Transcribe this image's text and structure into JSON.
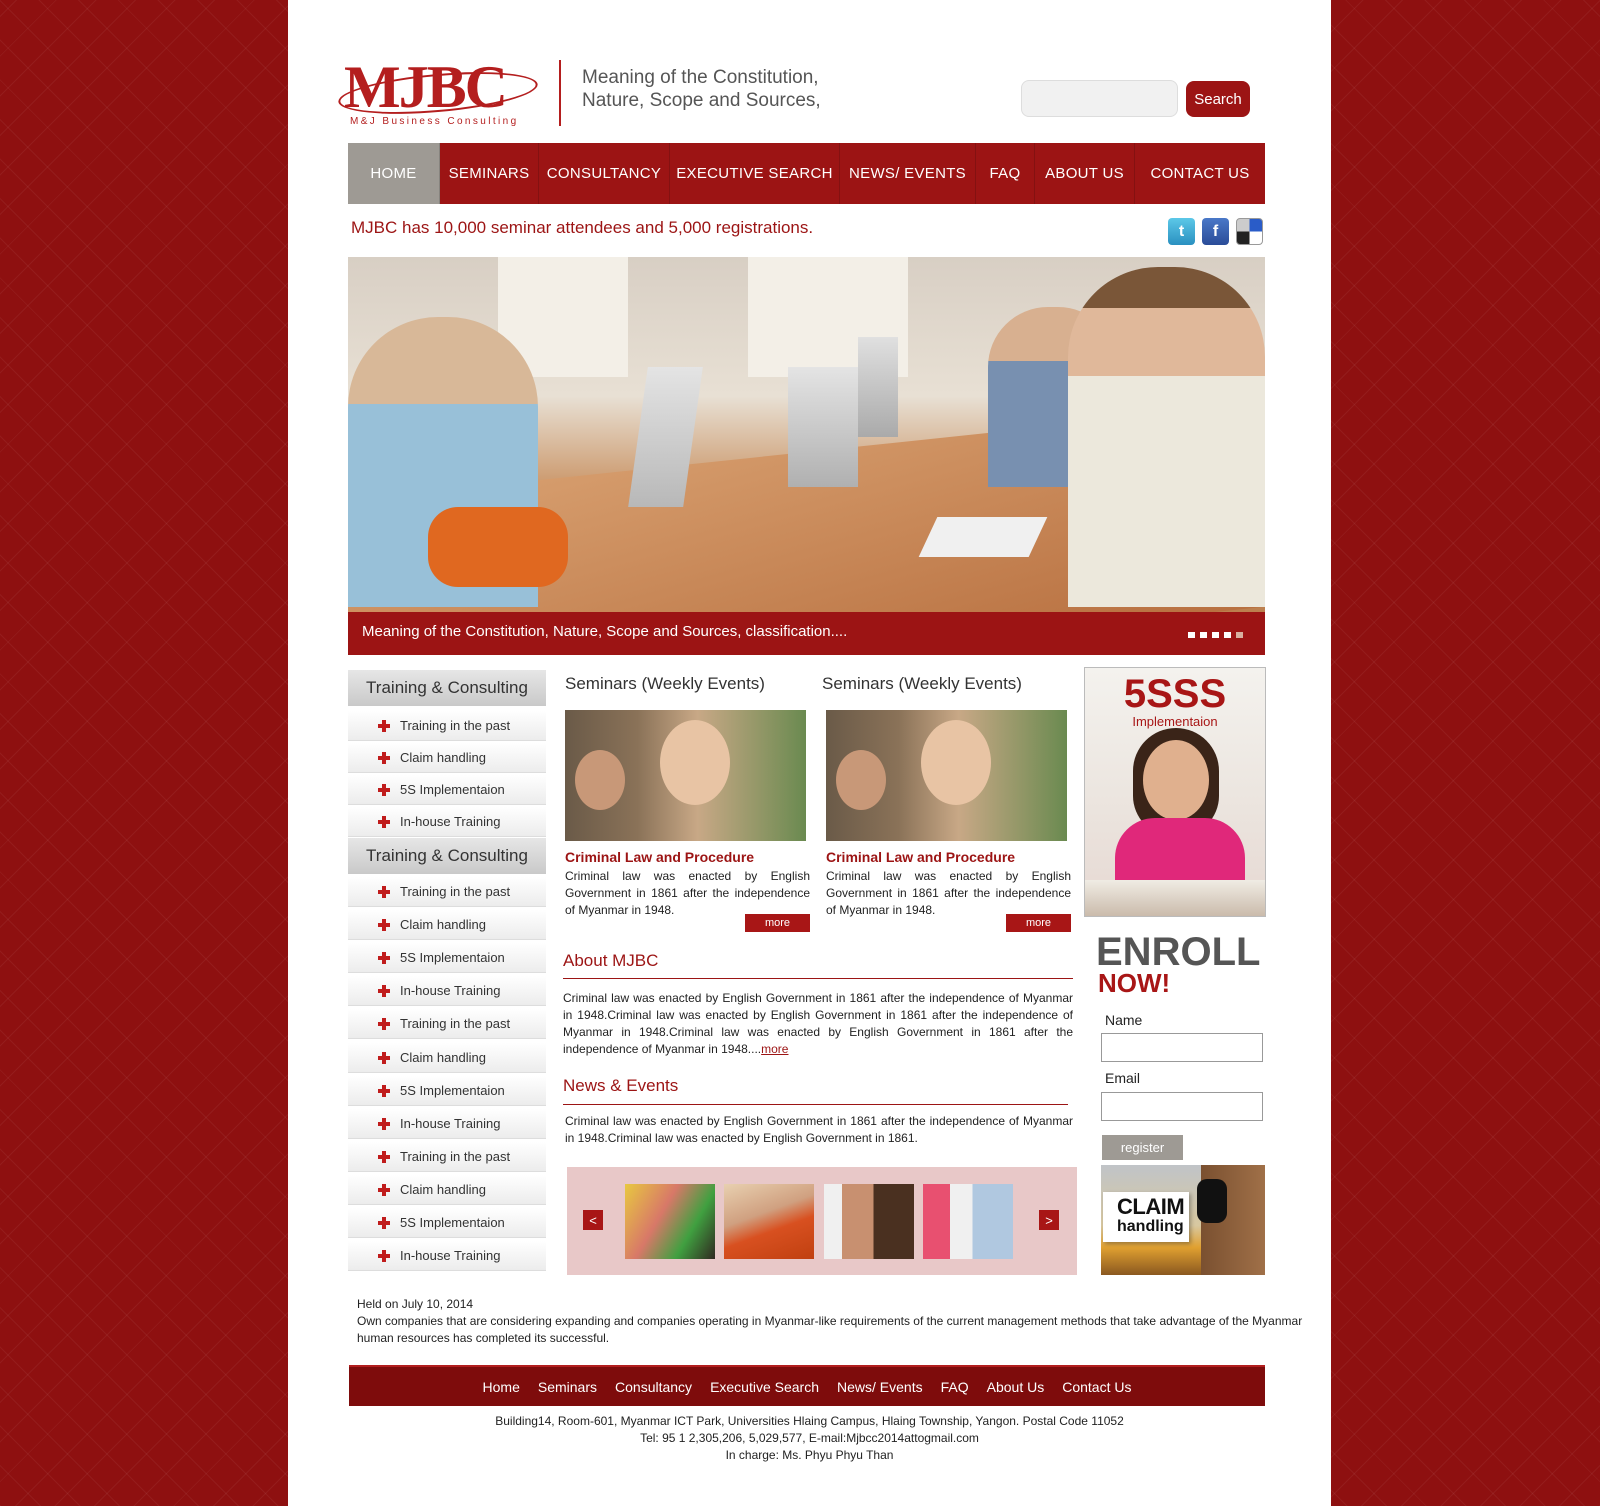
{
  "header": {
    "logo_text": "MJBC",
    "logo_subtitle": "M&J Business Consulting",
    "tagline_line1": "Meaning of the Constitution,",
    "tagline_line2": "Nature, Scope and Sources,",
    "search_placeholder": "",
    "search_label": "Search"
  },
  "nav": {
    "items": [
      "HOME",
      "SEMINARS",
      "CONSULTANCY",
      "EXECUTIVE SEARCH",
      "NEWS/ EVENTS",
      "FAQ",
      "ABOUT US",
      "CONTACT US"
    ],
    "active": "HOME"
  },
  "ticker": "MJBC has 10,000 seminar attendees and 5,000 registrations.",
  "social": {
    "twitter": "t",
    "facebook": "f",
    "delicious": ""
  },
  "hero": {
    "caption": "Meaning of the Constitution, Nature, Scope and Sources, classification...."
  },
  "sidebar": {
    "heading1": "Training & Consulting",
    "group1": [
      "Training in the past",
      "Claim handling",
      "5S Implementaion",
      "In-house Training"
    ],
    "heading2": "Training & Consulting",
    "group2": [
      "Training in the past",
      "Claim handling",
      "5S Implementaion",
      "In-house Training",
      "Training in the past",
      "Claim handling",
      "5S Implementaion",
      "In-house Training",
      "Training in the past",
      "Claim handling",
      "5S Implementaion",
      "In-house Training"
    ]
  },
  "seminars": [
    {
      "title": "Seminars (Weekly Events)",
      "subtitle": "Criminal Law and Procedure",
      "text": "Criminal law was enacted by English Government in 1861 after the independence of Myanmar in 1948.",
      "more": "more"
    },
    {
      "title": "Seminars (Weekly Events)",
      "subtitle": "Criminal Law and Procedure",
      "text": "Criminal law was enacted by English Government in 1861 after the independence of Myanmar in 1948.",
      "more": "more"
    }
  ],
  "about": {
    "title": "About MJBC",
    "text": "Criminal law was enacted by English Government in 1861 after the independence of Myanmar in 1948.Criminal law was enacted by English Government in 1861 after the independence of Myanmar in 1948.Criminal law was enacted by English Government in 1861 after the independence of Myanmar in 1948....",
    "more": "more"
  },
  "news": {
    "title": "News & Events",
    "text": "Criminal law was enacted by English Government in 1861 after the independence of Myanmar in 1948.Criminal law was enacted by English Government in 1861."
  },
  "gallery": {
    "prev": "<",
    "next": ">"
  },
  "promo": {
    "big": "5SSS",
    "small": "Implementaion"
  },
  "enroll": {
    "line1": "ENROLL",
    "line2": "NOW!",
    "name_label": "Name",
    "email_label": "Email",
    "name_value": "",
    "email_value": "",
    "register": "register"
  },
  "claim": {
    "line1": "CLAIM",
    "line2": "handling"
  },
  "held": {
    "date": "Held on July 10, 2014",
    "text": "Own companies that are considering expanding and companies operating in Myanmar-like requirements of the current management methods that take advantage of the Myanmar human resources has completed its successful."
  },
  "footer": {
    "nav": [
      "Home",
      "Seminars",
      "Consultancy",
      "Executive Search",
      "News/ Events",
      "FAQ",
      "About Us",
      "Contact Us"
    ],
    "address": "Building14, Room-601, Myanmar ICT Park, Universities Hlaing Campus, Hlaing Township, Yangon. Postal Code 11052",
    "contact": "Tel: 95 1 2,305,206, 5,029,577, E-mail:Mjbcc2014attogmail.com",
    "in_charge": "In charge: Ms. Phyu Phyu Than"
  },
  "colors": {
    "brand": "#9c1414",
    "nav_active": "#9e9a94",
    "background": "#8e1010"
  }
}
